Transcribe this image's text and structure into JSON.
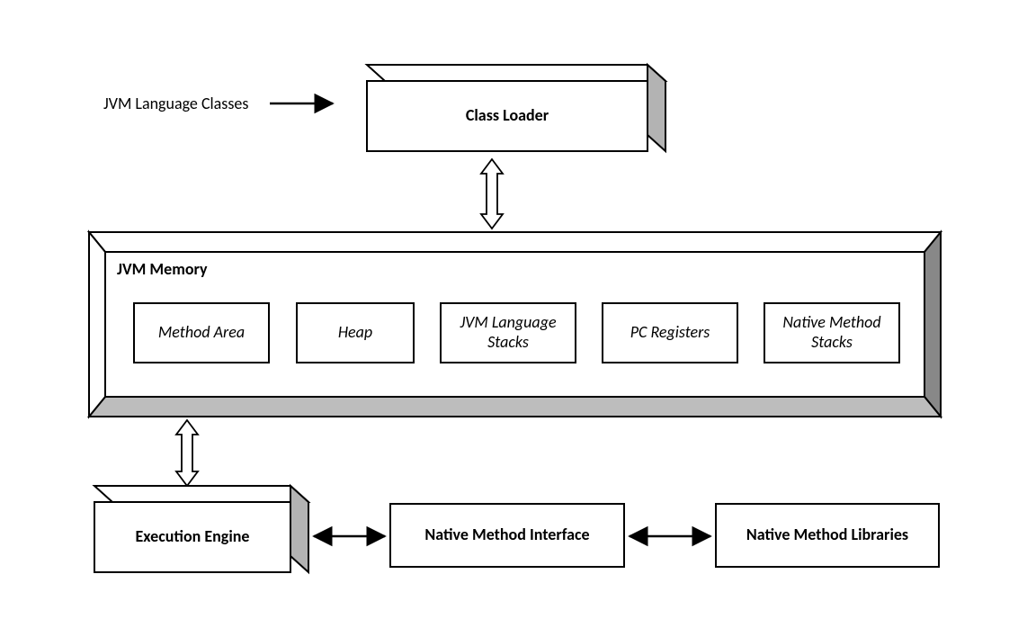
{
  "diagram": {
    "input_label": "JVM Language Classes",
    "class_loader": "Class Loader",
    "memory_title": "JVM Memory",
    "memory_areas": [
      "Method Area",
      "Heap",
      "JVM Language Stacks",
      "PC Registers",
      "Native Method Stacks"
    ],
    "execution_engine": "Execution Engine",
    "native_interface": "Native Method Interface",
    "native_libraries": "Native Method Libraries"
  }
}
